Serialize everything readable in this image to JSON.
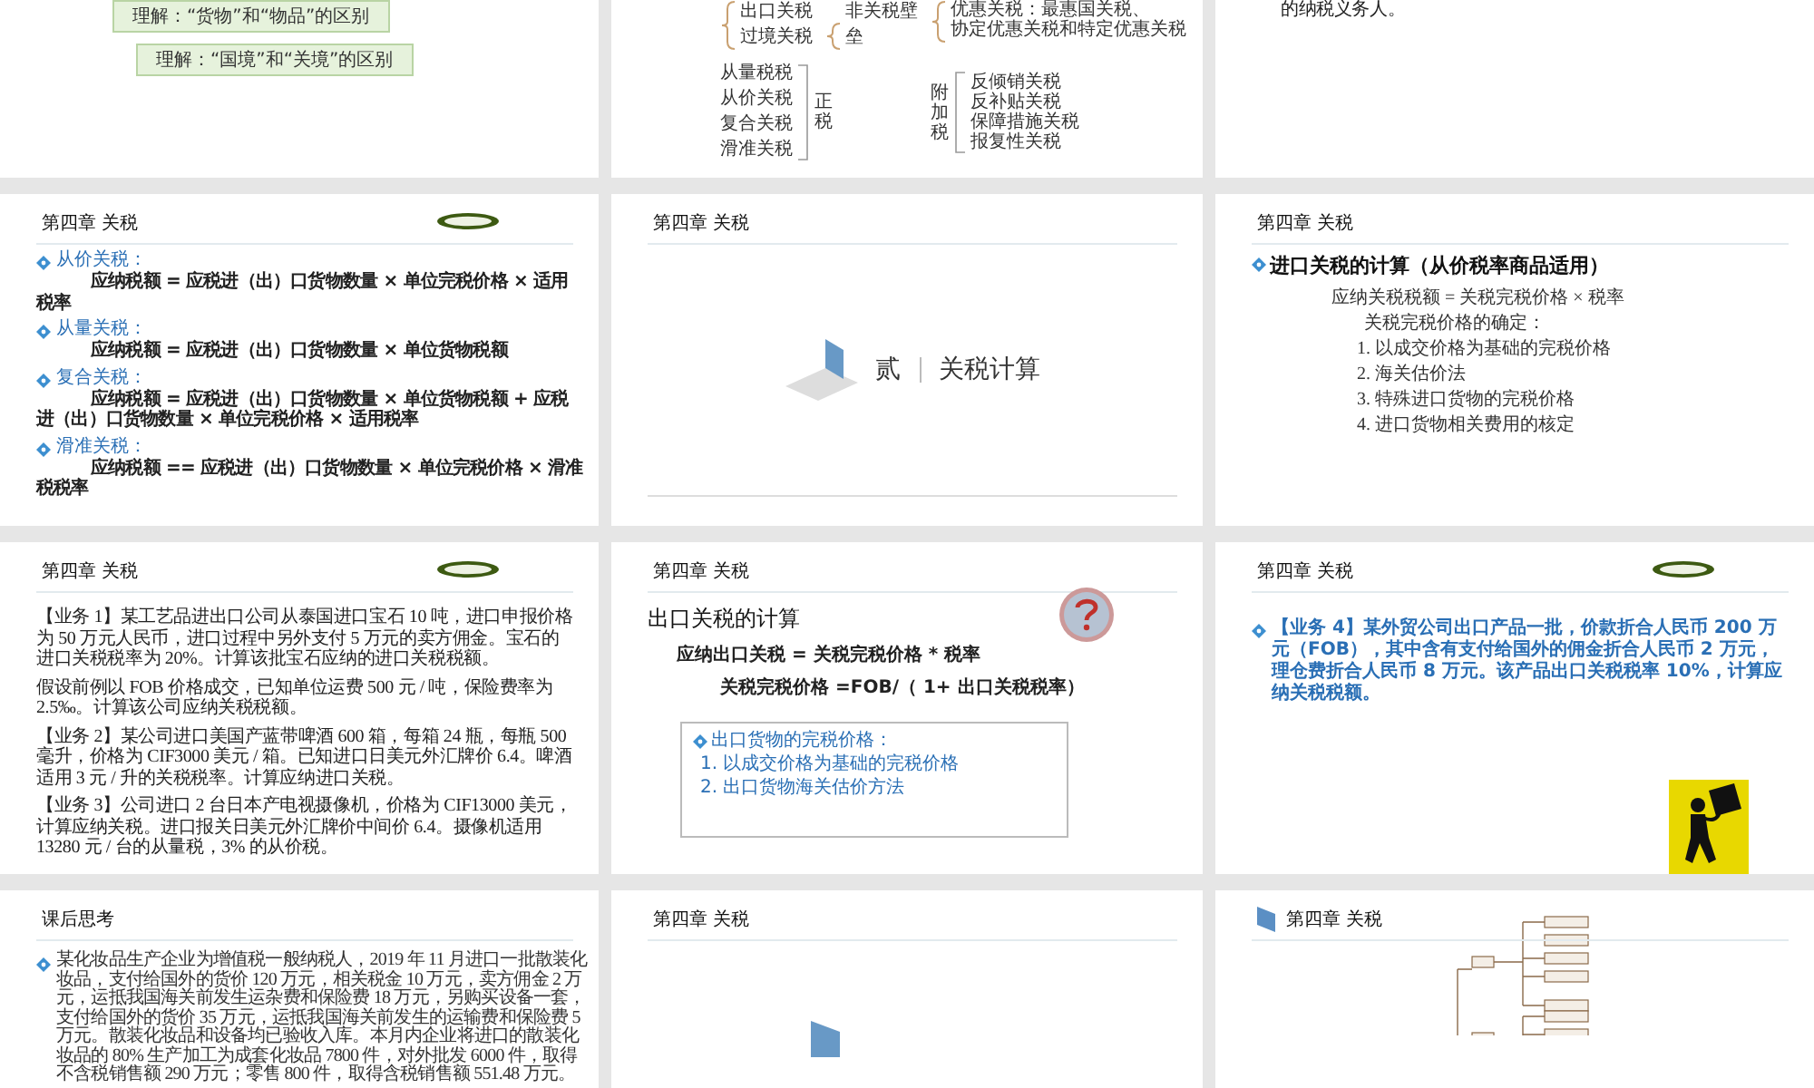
{
  "slides": [
    {
      "kind": "notes",
      "notes": [
        "理解：“货物”和“物品”的区别",
        "理解：“国境”和“关境”的区别"
      ]
    },
    {
      "kind": "tax_tree",
      "trade_types": [
        "出口关税",
        "过境关税"
      ],
      "barriers": [
        "非关税壁垒"
      ],
      "preferential": {
        "label": "优惠关税：",
        "detail": "最惠国关税、",
        "detail_2": "协定优惠关税和特定优惠关税"
      },
      "main_taxes": {
        "label": "正税",
        "items": [
          "从量税税",
          "从价关税",
          "复合关税",
          "滑准关税"
        ]
      },
      "surtaxes": {
        "label": "附加税",
        "items": [
          "反倾销关税",
          "反补贴关税",
          "保障措施关税",
          "报复性关税"
        ]
      }
    },
    {
      "kind": "text_tail",
      "text": "的纳税义务人。"
    },
    {
      "kind": "formulas",
      "header": "第四章 关税",
      "pill_icon": true,
      "items": [
        {
          "term": "从价关税：",
          "formula": "应纳税额 = 应税进（出）口货物数量 × 单位完税价格 × 适用税率"
        },
        {
          "term": "从量关税：",
          "formula": "应纳税额 = 应税进（出）口货物数量 × 单位货物税额"
        },
        {
          "term": "复合关税：",
          "formula": "应纳税额 = 应税进（出）口货物数量 × 单位货物税额 + 应税进（出）口货物数量 × 单位完税价格 × 适用税率"
        },
        {
          "term": "滑准关税：",
          "formula": "应纳税额 == 应税进（出）口货物数量 × 单位完税价格 × 滑准税税率"
        }
      ]
    },
    {
      "kind": "section",
      "header": "第四章 关税",
      "number": "贰",
      "title": "关税计算"
    },
    {
      "kind": "outline",
      "header": "第四章 关税",
      "heading": "进口关税的计算（从价税率商品适用）",
      "formula": "应纳关税税额 = 关税完税价格 × 税率",
      "sub": {
        "label": "关税完税价格的确定：",
        "children": [
          "1. 以成交价格为基础的完税价格",
          "2. 海关估价法",
          "3. 特殊进口货物的完税价格",
          "4. 进口货物相关费用的核定"
        ]
      }
    },
    {
      "kind": "cases",
      "header": "第四章 关税",
      "pill_icon": true,
      "paragraphs": [
        "【业务 1】某工艺品进出口公司从泰国进口宝石 10 吨，进口申报价格为 50 万元人民币，进口过程中另外支付 5 万元的卖方佣金。宝石的进口关税税率为 20%。计算该批宝石应纳的进口关税税额。",
        "假设前例以 FOB 价格成交，已知单位运费 500 元 / 吨，保险费率为 2.5‰。计算该公司应纳关税税额。",
        "【业务 2】某公司进口美国产蓝带啤酒 600 箱，每箱 24 瓶，每瓶 500 毫升，价格为 CIF3000 美元 / 箱。已知进口日美元外汇牌价 6.4。啤酒适用 3 元 / 升的关税税率。计算应纳进口关税。",
        "【业务 3】公司进口 2 台日本产电视摄像机，价格为 CIF13000 美元，计算应纳关税。进口报关日美元外汇牌价中间价 6.4。摄像机适用 13280 元 / 台的从量税，3% 的从价税。"
      ]
    },
    {
      "kind": "export_calc",
      "header": "第四章 关税",
      "help_icon": true,
      "title": "出口关税的计算",
      "formulas": [
        "应纳出口关税 = 关税完税价格 * 税率",
        "关税完税价格 =FOB/（ 1+ 出口关税税率）"
      ],
      "box": {
        "heading": "出口货物的完税价格：",
        "items": [
          "1. 以成交价格为基础的完税价格",
          "2. 出口货物海关估价方法"
        ]
      }
    },
    {
      "kind": "case_note",
      "header": "第四章 关税",
      "pill_icon": true,
      "text": "【业务 4】某外贸公司出口产品一批，价款折合人民币 200 万元（FOB），其中含有支付给国外的佣金折合人民币 2 万元，理仓费折合人民币 8 万元。该产品出口关税税率 10%，计算应纳关税税额。"
    },
    {
      "kind": "homework",
      "header": "课后思考",
      "text": "某化妆品生产企业为增值税一般纳税人，2019 年 11 月进口一批散装化妆品，支付给国外的货价 120 万元，相关税金 10 万元，卖方佣金 2 万元，运抵我国海关前发生运杂费和保险费 18 万元，另购买设备一套，支付给国外的货价 35 万元，运抵我国海关前发生的运输费和保险费 5 万元。散装化妆品和设备均已验收入库。本月内企业将进口的散装化妆品的 80% 生产加工为成套化妆品 7800 件，对外批发 6000 件，取得不含税销售额 290 万元；零售 800 件，取得含税销售额 551.48 万元。"
    },
    {
      "kind": "section_cut",
      "header": "第四章 关税"
    },
    {
      "kind": "mindmap",
      "header": "第四章 关税"
    }
  ]
}
